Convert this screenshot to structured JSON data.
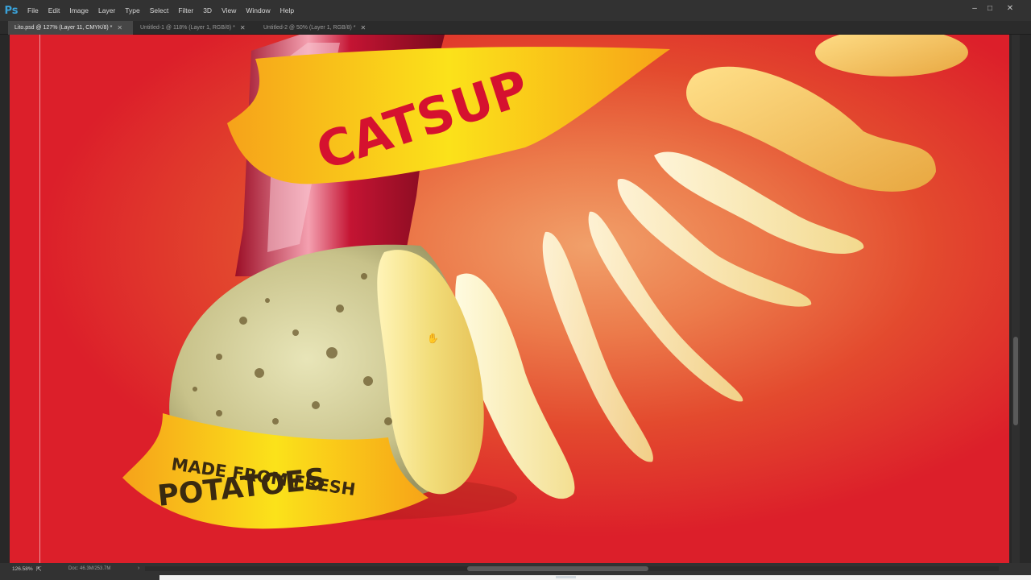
{
  "app": {
    "logo": "Ps"
  },
  "menu": [
    "File",
    "Edit",
    "Image",
    "Layer",
    "Type",
    "Select",
    "Filter",
    "3D",
    "View",
    "Window",
    "Help"
  ],
  "window_controls": {
    "minimize": "–",
    "maximize": "□",
    "close": "✕"
  },
  "tabs": [
    {
      "label": "Lito.psd @ 127% (Layer 11, CMYK/8) *",
      "close": "✕"
    },
    {
      "label": "Untitled-1 @ 118% (Layer 1, RGB/8) *",
      "close": "✕"
    },
    {
      "label": "Untitled-2 @ 50% (Layer 1, RGB/8) *",
      "close": "✕"
    }
  ],
  "artwork": {
    "banner_top": "CATSUP",
    "banner_bottom_line1": "MADE FROM FRESH",
    "banner_bottom_line2": "POTATOES"
  },
  "status": {
    "zoom": "126.58%",
    "doc": "Doc: 46.3M/253.7M",
    "arrow": "›"
  },
  "cursor_icon": "hand-icon"
}
